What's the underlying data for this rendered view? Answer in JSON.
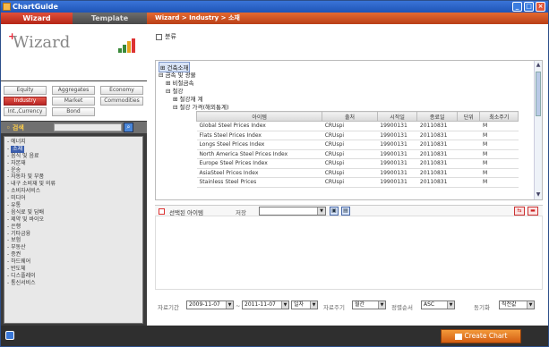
{
  "window": {
    "title": "ChartGuide"
  },
  "left": {
    "tabs": {
      "wizard": "Wizard",
      "template": "Template"
    },
    "logo_text": "Wizard",
    "categories": [
      "Equity",
      "Aggregates",
      "Economy",
      "Industry",
      "Market",
      "Commodities",
      "Int.,Currency",
      "Bond"
    ],
    "selected_category": "Industry",
    "search_label": "검색",
    "search_value": "",
    "industries": [
      "에너지",
      "소재",
      "음식 및 음료",
      "자본재",
      "운송",
      "자동차 및 부품",
      "내구 소비재 및 의류",
      "소비자서비스",
      "미디어",
      "유통",
      "음식료 및 담배",
      "제약 및 바이오",
      "은행",
      "기타금융",
      "보험",
      "부동산",
      "증권",
      "하드웨어",
      "반도체",
      "디스플레이",
      "통신서비스"
    ],
    "selected_industry": "소재"
  },
  "main": {
    "breadcrumb": "Wizard > Industry > 소재",
    "classification_label": "분류",
    "tree": {
      "root": "건축소재",
      "node1": "금속 및 광물",
      "node2": "비철금속",
      "node3": "철강",
      "node4": "철강재 계",
      "node5": "철강 가격(해외통계)"
    },
    "columns": [
      "아이템",
      "출처",
      "시작일",
      "종료일",
      "단위",
      "최소주기"
    ],
    "rows": [
      [
        "Global Steel Prices Index",
        "CRUspi",
        "19900131",
        "20110831",
        "",
        "M"
      ],
      [
        "Flats Steel Prices Index",
        "CRUspi",
        "19900131",
        "20110831",
        "",
        "M"
      ],
      [
        "Longs Steel Prices Index",
        "CRUspi",
        "19900131",
        "20110831",
        "",
        "M"
      ],
      [
        "North America Steel Prices Index",
        "CRUspi",
        "19900131",
        "20110831",
        "",
        "M"
      ],
      [
        "Europe Steel Prices Index",
        "CRUspi",
        "19900131",
        "20110831",
        "",
        "M"
      ],
      [
        "AsiaSteel Prices Index",
        "CRUspi",
        "19900131",
        "20110831",
        "",
        "M"
      ],
      [
        "Stainless Steel Prices",
        "CRUspi",
        "19900131",
        "20110831",
        "",
        "M"
      ]
    ],
    "selected_items_label": "선택된 아이템",
    "save_label": "저장",
    "save_select_value": "",
    "period": {
      "label": "자료기간",
      "start": "2009-11-07",
      "separator": "~",
      "end": "2011-11-07",
      "unit": "일자",
      "freq_label": "자료주기",
      "freq": "월간",
      "sort_label": "정렬순서",
      "sort": "ASC",
      "sync_label": "동기화",
      "sync": "직전값"
    }
  },
  "bottom": {
    "create_chart": "Create Chart"
  },
  "colors": {
    "accent": "#d35d12",
    "wizard_red": "#c0302a",
    "dark_panel": "#3c3c3c"
  }
}
